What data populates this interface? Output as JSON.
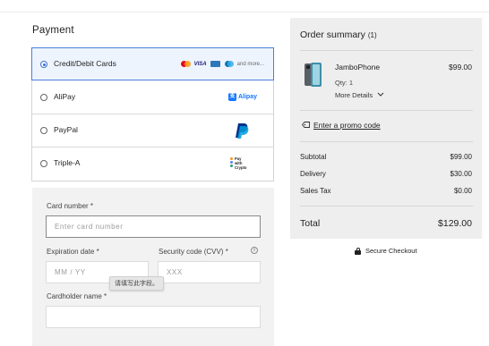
{
  "payment": {
    "title": "Payment",
    "methods": [
      {
        "label": "Credit/Debit Cards",
        "selected": true,
        "logos": [
          "mastercard-icon",
          "visa-icon",
          "amex-icon",
          "diners-icon"
        ],
        "more": "and more..."
      },
      {
        "label": "AliPay",
        "selected": false,
        "logo_text": "Alipay"
      },
      {
        "label": "PayPal",
        "selected": false
      },
      {
        "label": "Triple-A",
        "selected": false,
        "logo_text": "Pay with Crypto"
      }
    ],
    "card_form": {
      "card_number_label": "Card number *",
      "card_number_placeholder": "Enter card number",
      "expiration_label": "Expiration date *",
      "expiration_placeholder": "MM / YY",
      "cvv_label": "Security code (CVV) *",
      "cvv_placeholder": "XXX",
      "cardholder_label": "Cardholder name *",
      "tooltip": "请填写此字段。"
    }
  },
  "summary": {
    "title": "Order summary",
    "count": "(1)",
    "item": {
      "name": "JamboPhone",
      "price": "$99.00",
      "qty": "Qty: 1",
      "more": "More Details"
    },
    "promo": "Enter a promo code",
    "rows": [
      {
        "label": "Subtotal",
        "value": "$99.00"
      },
      {
        "label": "Delivery",
        "value": "$30.00"
      },
      {
        "label": "Sales Tax",
        "value": "$0.00"
      }
    ],
    "total_label": "Total",
    "total_value": "$129.00"
  },
  "secure_checkout": "Secure Checkout",
  "colors": {
    "accent": "#3a6fd0",
    "selected_bg": "#eef4fd",
    "panel_bg": "#f2f2f2",
    "summary_bg": "#eeeeee"
  }
}
